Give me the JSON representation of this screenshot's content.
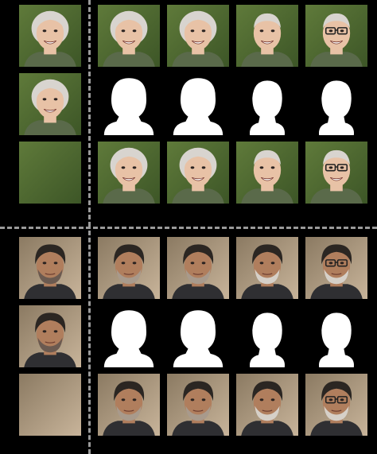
{
  "palette": {
    "background": "#000000",
    "separator": "#9a9a9a",
    "mask": "#ffffff",
    "bg_green": "#5f7a3a",
    "bg_green_dark": "#3d5627",
    "bg_studio": "#8b7a62",
    "bg_studio_light": "#c8b49a",
    "skin_light": "#e8c2a6",
    "skin_dark": "#b07e5d",
    "hair_white": "#d8d4cf",
    "hair_black": "#2b2622",
    "beard_white": "#d6d0c8",
    "shirt_dark": "#2f2f32"
  },
  "groups": [
    {
      "name": "woman",
      "rows": [
        [
          "face-woman-source",
          "face-woman-edit",
          "face-woman-edit",
          "face-woman-edit-short-hair",
          "face-woman-edit-glasses"
        ],
        [
          "face-woman-reference",
          "mask-woman",
          "mask-woman",
          "mask-woman-short",
          "mask-woman-short"
        ],
        [
          "background-green",
          "face-woman-edit",
          "face-woman-edit",
          "face-woman-edit-short-hair",
          "face-woman-edit-glasses"
        ]
      ]
    },
    {
      "name": "man",
      "rows": [
        [
          "face-man-source",
          "face-man-edit",
          "face-man-edit",
          "face-man-edit-white-beard",
          "face-man-edit-glasses"
        ],
        [
          "face-man-reference",
          "mask-man",
          "mask-man",
          "mask-man-short",
          "mask-man-short"
        ],
        [
          "background-studio",
          "face-man-edit",
          "face-man-edit",
          "face-man-edit-white-beard",
          "face-man-edit-glasses"
        ]
      ]
    }
  ]
}
